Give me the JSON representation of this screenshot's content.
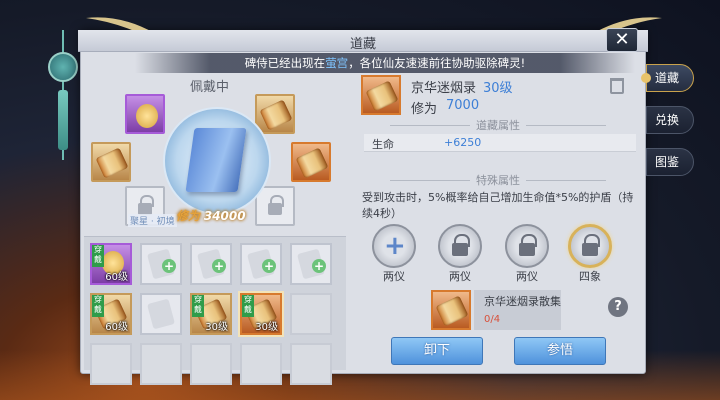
{
  "window": {
    "title": "道藏",
    "close_label": "✕"
  },
  "notice": {
    "prefix": "碑侍已经出现在",
    "highlight": "萤宫",
    "suffix": "，各位仙友速速前往协助驱除碑灵!"
  },
  "equip": {
    "wearing_label": "佩戴中",
    "power_label": "修为",
    "power_value": "34000",
    "fragment_tag": "聚星 · 初境"
  },
  "grid": {
    "cells": [
      {
        "state": "purple",
        "tag": "穿戴",
        "level": "60级"
      },
      {
        "state": "ghost-plus"
      },
      {
        "state": "ghost-plus"
      },
      {
        "state": "ghost-plus"
      },
      {
        "state": "ghost-plus"
      },
      {
        "state": "gold",
        "tag": "穿戴",
        "level": "60级"
      },
      {
        "state": "ghost"
      },
      {
        "state": "gold",
        "tag": "穿戴",
        "level": "30级"
      },
      {
        "state": "orange-selected",
        "tag": "穿戴",
        "level": "30级"
      },
      {
        "state": "empty"
      }
    ]
  },
  "detail": {
    "name": "京华迷烟录",
    "level": "30级",
    "xiuwei_label": "修为",
    "xiuwei_value": "7000",
    "section_attr": "道藏属性",
    "attr_name": "生命",
    "attr_value": "+6250",
    "section_special": "特殊属性",
    "special_desc": "受到攻击时，5%概率给自己增加生命值*5%的护盾（持续4秒）",
    "skills": [
      {
        "label": "两仪",
        "icon": "plus-icon"
      },
      {
        "label": "两仪",
        "icon": "lock-icon"
      },
      {
        "label": "两仪",
        "icon": "lock-icon"
      },
      {
        "label": "四象",
        "icon": "lock-icon"
      }
    ],
    "fragment_name": "京华迷烟录散集",
    "fragment_count": "0/4",
    "help_label": "?",
    "unequip_label": "卸下",
    "enlighten_label": "参悟"
  },
  "sidetabs": [
    {
      "label": "道藏",
      "active": true
    },
    {
      "label": "兑换",
      "active": false
    },
    {
      "label": "图鉴",
      "active": false
    }
  ]
}
